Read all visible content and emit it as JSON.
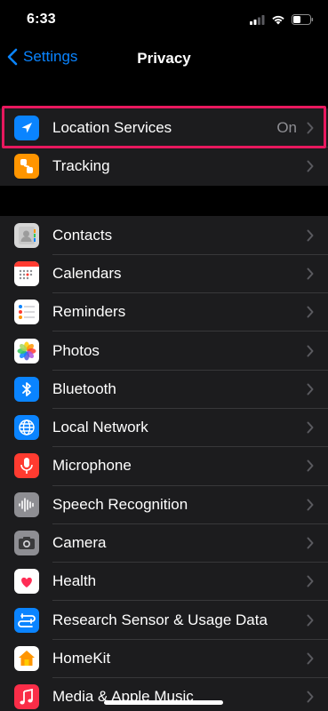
{
  "status": {
    "time": "6:33"
  },
  "nav": {
    "back_label": "Settings",
    "title": "Privacy"
  },
  "colors": {
    "accent": "#0a84ff",
    "highlight": "#e8185e",
    "cell": "#1c1c1e",
    "chevron": "#5a5a5f",
    "value": "#8e8e93"
  },
  "group1": [
    {
      "label": "Location Services",
      "value": "On",
      "icon": "location-arrow-icon",
      "icon_bg": "#0a84ff"
    },
    {
      "label": "Tracking",
      "icon": "tracking-icon",
      "icon_bg": "#ff9500"
    }
  ],
  "group2": [
    {
      "label": "Contacts",
      "icon": "contacts-icon",
      "icon_bg": "#d6d6d6"
    },
    {
      "label": "Calendars",
      "icon": "calendar-icon",
      "icon_bg": "#ffffff"
    },
    {
      "label": "Reminders",
      "icon": "reminders-icon",
      "icon_bg": "#ffffff"
    },
    {
      "label": "Photos",
      "icon": "photos-icon",
      "icon_bg": "#ffffff"
    },
    {
      "label": "Bluetooth",
      "icon": "bluetooth-icon",
      "icon_bg": "#0a84ff"
    },
    {
      "label": "Local Network",
      "icon": "globe-icon",
      "icon_bg": "#0a84ff"
    },
    {
      "label": "Microphone",
      "icon": "microphone-icon",
      "icon_bg": "#ff3b30"
    },
    {
      "label": "Speech Recognition",
      "icon": "waveform-icon",
      "icon_bg": "#8e8e93"
    },
    {
      "label": "Camera",
      "icon": "camera-icon",
      "icon_bg": "#8e8e93"
    },
    {
      "label": "Health",
      "icon": "heart-icon",
      "icon_bg": "#ffffff"
    },
    {
      "label": "Research Sensor & Usage Data",
      "icon": "research-icon",
      "icon_bg": "#0a84ff"
    },
    {
      "label": "HomeKit",
      "icon": "house-icon",
      "icon_bg": "#ffffff"
    },
    {
      "label": "Media & Apple Music",
      "icon": "music-note-icon",
      "icon_bg": "#fa2d48"
    }
  ]
}
